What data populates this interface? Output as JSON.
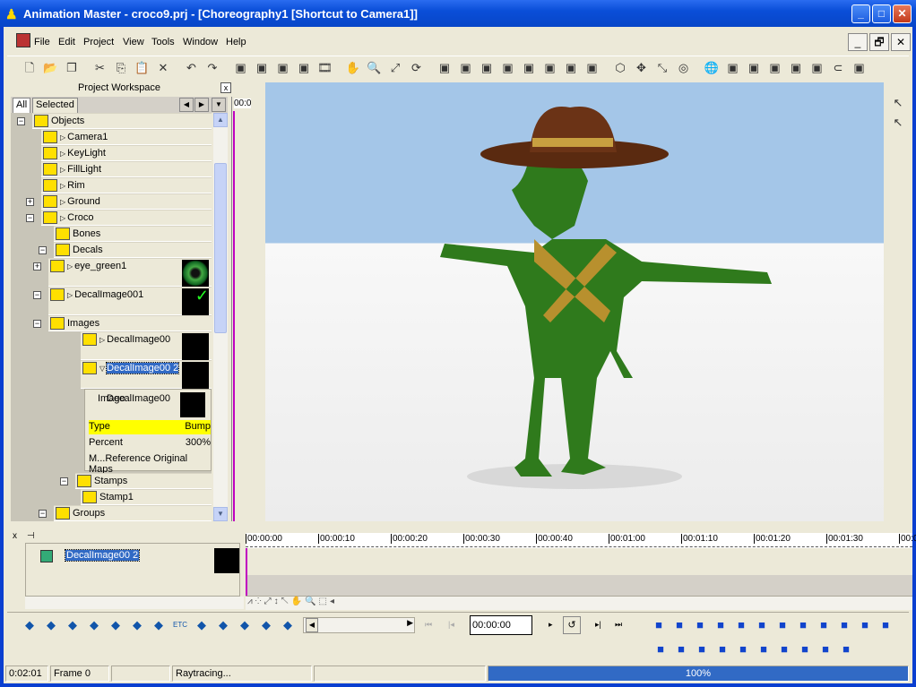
{
  "window": {
    "title": "Animation Master - croco9.prj - [Choreography1 [Shortcut to Camera1]]",
    "minimize": "_",
    "maximize": "□",
    "close": "✕"
  },
  "menu": [
    "File",
    "Edit",
    "Project",
    "View",
    "Tools",
    "Window",
    "Help"
  ],
  "mdi_controls": [
    "_",
    "🗗",
    "✕"
  ],
  "toolbar_icons": [
    "new-icon",
    "open-icon",
    "save-all-icon",
    "cut-icon",
    "copy-icon",
    "paste-icon",
    "delete-icon",
    "undo-icon",
    "redo-icon",
    "group-icon",
    "add-icon",
    "lock-icon",
    "unlock-icon",
    "film-icon",
    "hand-icon",
    "zoom-icon",
    "fit-icon",
    "rotate-icon",
    "bone-icon",
    "model-icon",
    "bones-icon",
    "muscle-icon",
    "pose-icon",
    "skin-icon",
    "smooth-icon",
    "megaphone-icon",
    "cube-icon",
    "move-icon",
    "scale-icon",
    "sphere-icon",
    "globe-icon",
    "path-icon",
    "chart-icon",
    "select-icon",
    "ruler-icon",
    "render-icon",
    "magnet-icon",
    "gear-icon"
  ],
  "workspace": {
    "title": "Project Workspace",
    "tabs": [
      "All",
      "Selected"
    ],
    "tree": [
      {
        "label": "Objects",
        "depth": 0,
        "toggle": "−",
        "icon": "objects-folder-icon"
      },
      {
        "label": "Camera1",
        "depth": 1,
        "icon": "camera-icon",
        "arrow": true
      },
      {
        "label": "KeyLight",
        "depth": 1,
        "icon": "light-icon",
        "arrow": true
      },
      {
        "label": "FillLight",
        "depth": 1,
        "icon": "light-icon",
        "arrow": true
      },
      {
        "label": "Rim",
        "depth": 1,
        "icon": "rim-light-icon",
        "arrow": true
      },
      {
        "label": "Ground",
        "depth": 1,
        "toggle": "+",
        "icon": "model-icon",
        "arrow": true
      },
      {
        "label": "Croco",
        "depth": 1,
        "toggle": "−",
        "icon": "model-icon",
        "arrow": true
      },
      {
        "label": "Bones",
        "depth": 2,
        "icon": "bones-folder-icon"
      },
      {
        "label": "Decals",
        "depth": 2,
        "toggle": "−",
        "icon": "decals-folder-icon"
      },
      {
        "label": "eye_green1",
        "depth": 3,
        "toggle": "+",
        "icon": "decal-star-icon",
        "arrow": true,
        "thumb": "eye"
      },
      {
        "label": "DecalImage001",
        "depth": 3,
        "toggle": "−",
        "icon": "decal-star-icon",
        "arrow": true,
        "thumb": "check"
      },
      {
        "label": "Images",
        "depth": 3,
        "toggle": "−",
        "icon": "images-folder-icon"
      },
      {
        "label": "DecalImage00",
        "depth": 4,
        "icon": "image-icon",
        "arrow": true,
        "thumb": "black"
      },
      {
        "label": "DecalImage00 2",
        "depth": 4,
        "icon": "image-icon",
        "arrow": true,
        "thumb": "black",
        "selected": true
      }
    ],
    "props": {
      "image_label": "Image",
      "image_value": "DecalImage00",
      "type_label": "Type",
      "type_value": "Bump",
      "percent_label": "Percent",
      "percent_value": "300%",
      "maps_label": "M...Reference Original Maps"
    },
    "tree2": [
      {
        "label": "Stamps",
        "toggle": "−",
        "icon": "stamps-folder-icon"
      },
      {
        "label": "Stamp1",
        "icon": "stamp-icon"
      },
      {
        "label": "Groups",
        "toggle": "−",
        "icon": "groups-folder-icon"
      }
    ],
    "mini_time": "00:0"
  },
  "timeline": {
    "ticks": [
      "00:00:00",
      "00:00:10",
      "00:00:20",
      "00:00:30",
      "00:00:40",
      "00:01:00",
      "00:01:10",
      "00:01:20",
      "00:01:30",
      "00:0"
    ],
    "item": "DecalImage00 2",
    "current_time": "00:00:00"
  },
  "status": {
    "time": "0:02:01",
    "frame": "Frame 0",
    "message": "Raytracing...",
    "progress_label": "100%",
    "progress": 100
  },
  "colors": {
    "title_blue": "#0a4ed8",
    "selection": "#316ac5",
    "highlight": "#ffff00",
    "progress": "#316ac5",
    "sky": "#a4c6e8",
    "croco": "#2f7a1c"
  }
}
